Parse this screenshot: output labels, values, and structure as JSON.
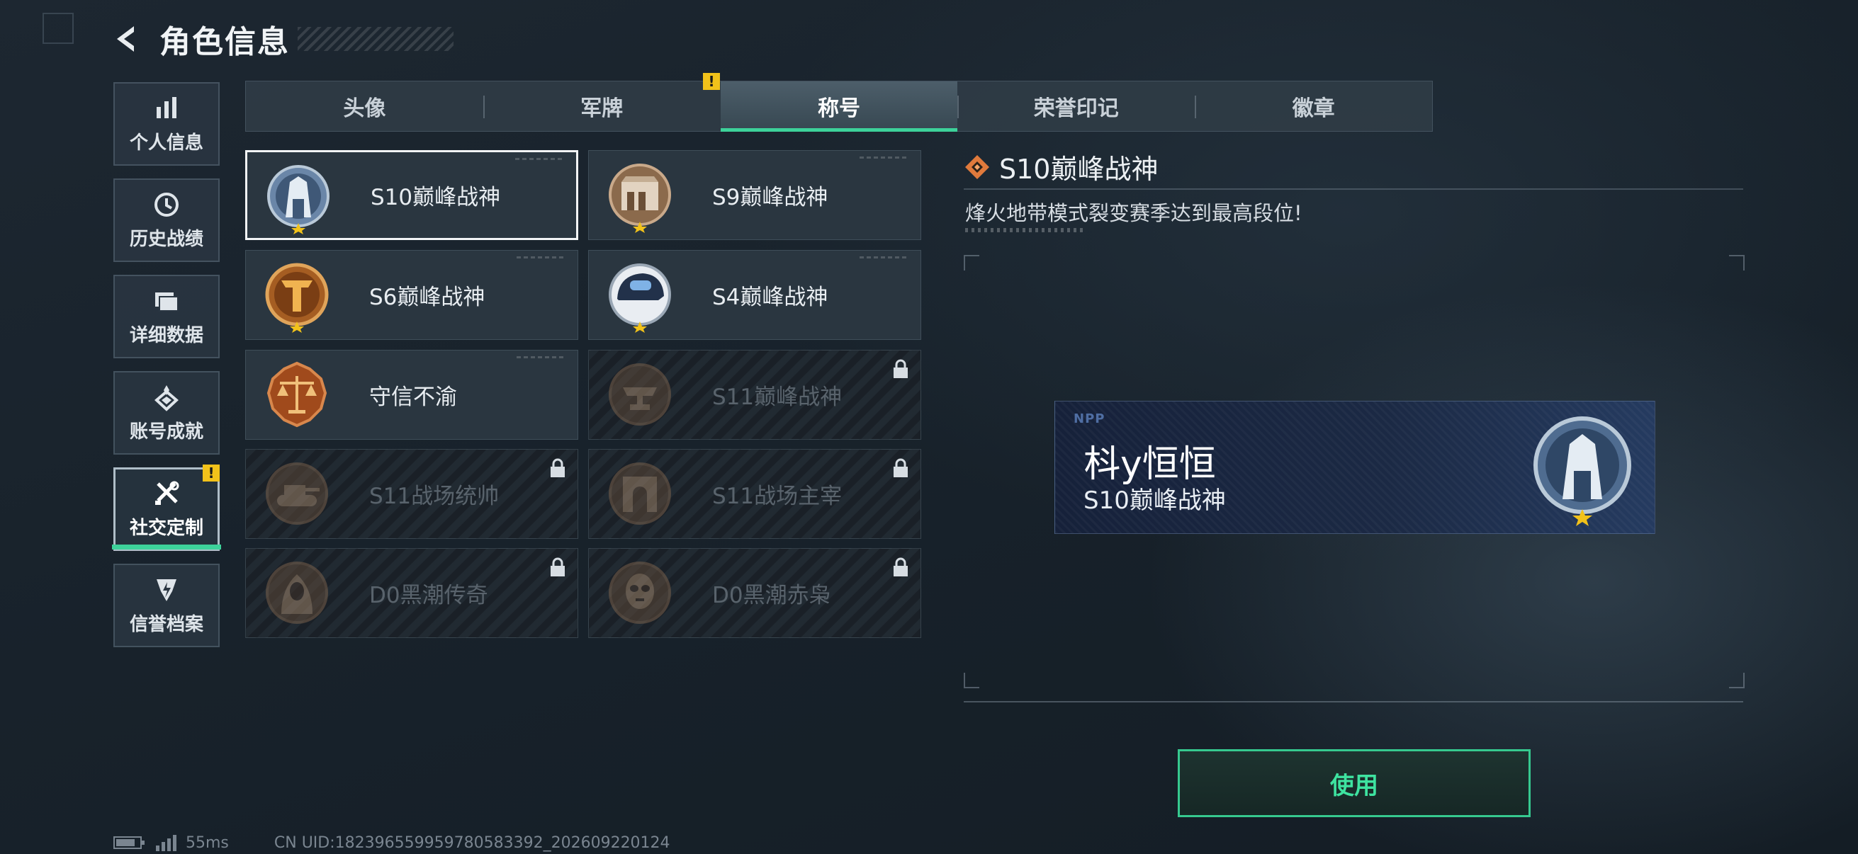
{
  "header": {
    "title": "角色信息"
  },
  "sidebar": {
    "items": [
      {
        "label": "个人信息",
        "icon": "bar-chart-icon"
      },
      {
        "label": "历史战绩",
        "icon": "history-icon"
      },
      {
        "label": "详细数据",
        "icon": "folder-icon"
      },
      {
        "label": "账号成就",
        "icon": "achievement-icon"
      },
      {
        "label": "社交定制",
        "icon": "tools-icon",
        "active": true,
        "alert": "!"
      },
      {
        "label": "信誉档案",
        "icon": "credit-shield-icon"
      }
    ]
  },
  "tabs": [
    {
      "label": "头像"
    },
    {
      "label": "军牌",
      "alert": "!"
    },
    {
      "label": "称号",
      "active": true
    },
    {
      "label": "荣誉印记"
    },
    {
      "label": "徽章"
    }
  ],
  "titles": [
    {
      "name": "S10巅峰战神",
      "emblem": "silver-tower-emblem",
      "selected": true,
      "locked": false
    },
    {
      "name": "S9巅峰战神",
      "emblem": "bronze-fortress-emblem",
      "locked": false
    },
    {
      "name": "S6巅峰战神",
      "emblem": "gold-t-emblem",
      "locked": false
    },
    {
      "name": "S4巅峰战神",
      "emblem": "helmet-emblem",
      "locked": false
    },
    {
      "name": "守信不渝",
      "emblem": "scales-emblem",
      "locked": false
    },
    {
      "name": "S11巅峰战神",
      "emblem": "anvil-emblem",
      "locked": true
    },
    {
      "name": "S11战场统帅",
      "emblem": "tank-emblem",
      "locked": true
    },
    {
      "name": "S11战场主宰",
      "emblem": "arch-emblem",
      "locked": true
    },
    {
      "name": "D0黑潮传奇",
      "emblem": "hooded-figure-emblem",
      "locked": true
    },
    {
      "name": "D0黑潮赤枭",
      "emblem": "skull-mask-emblem",
      "locked": true
    }
  ],
  "detail": {
    "title": "S10巅峰战神",
    "description": "烽火地带模式裂变赛季达到最高段位!"
  },
  "preview": {
    "brand": "NPP",
    "player_name": "枓y恒恒",
    "title": "S10巅峰战神"
  },
  "use_button": "使用",
  "status": {
    "ping": "55ms",
    "uid": "CN UID:182396559959780583392_202609220124"
  },
  "colors": {
    "accent": "#3dd29a",
    "alert": "#f2c21a",
    "detail_diamond": "#e07a3c"
  }
}
